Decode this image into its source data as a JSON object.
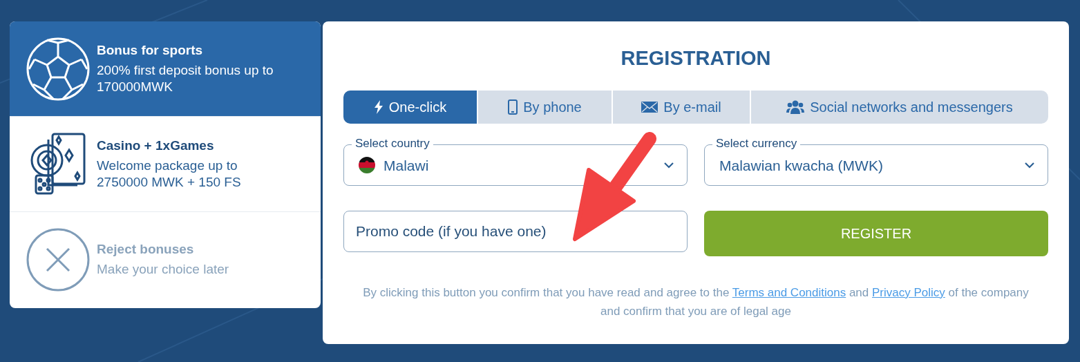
{
  "bonuses": [
    {
      "kind": "sports",
      "title": "Bonus for sports",
      "text": "200% first deposit bonus up to 170000MWK",
      "selected": true
    },
    {
      "kind": "casino",
      "title": "Casino + 1xGames",
      "text": "Welcome package up to 2750000 MWK + 150 FS",
      "selected": false
    },
    {
      "kind": "reject",
      "title": "Reject bonuses",
      "text": "Make your choice later",
      "selected": false
    }
  ],
  "registration": {
    "title": "REGISTRATION",
    "tabs": [
      {
        "kind": "bolt",
        "label": "One-click",
        "selected": true
      },
      {
        "kind": "phone",
        "label": "By phone",
        "selected": false
      },
      {
        "kind": "mail",
        "label": "By e-mail",
        "selected": false
      },
      {
        "kind": "people",
        "label": "Social networks and messengers",
        "selected": false
      }
    ],
    "country": {
      "label": "Select country",
      "value": "Malawi"
    },
    "currency": {
      "label": "Select currency",
      "value": "Malawian kwacha (MWK)"
    },
    "promo": {
      "placeholder": "Promo code (if you have one)"
    },
    "register_button": "REGISTER",
    "legal": [
      {
        "kind": "text",
        "text": "By clicking this button you confirm that you have read and agree to the "
      },
      {
        "kind": "link",
        "text": "Terms and Conditions"
      },
      {
        "kind": "text",
        "text": " and "
      },
      {
        "kind": "link",
        "text": "Privacy Policy"
      },
      {
        "kind": "text",
        "text": " of the company and confirm that you are of legal age"
      }
    ]
  }
}
